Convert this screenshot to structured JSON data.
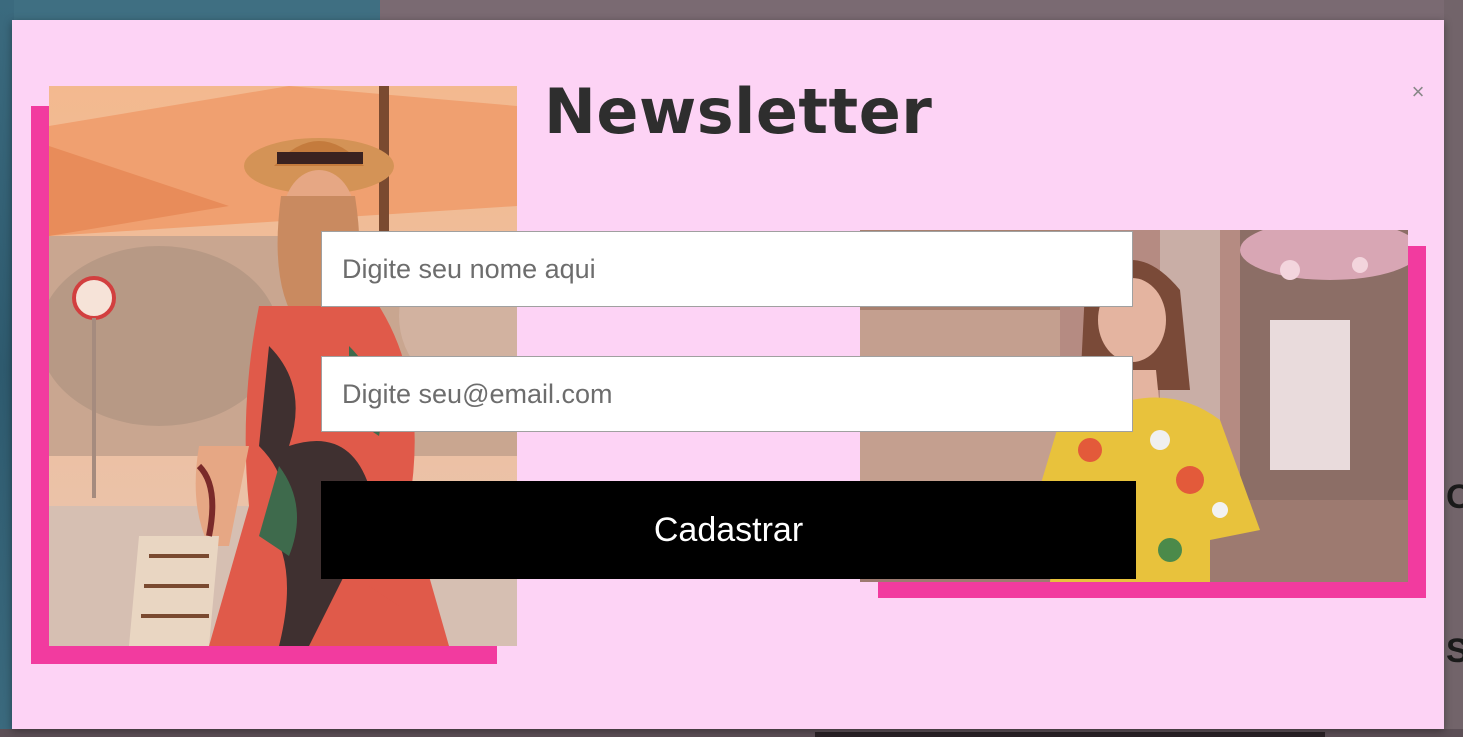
{
  "modal": {
    "title": "Newsletter",
    "close_symbol": "×",
    "name_placeholder": "Digite seu nome aqui",
    "email_placeholder": "Digite seu@email.com",
    "submit_label": "Cadastrar"
  },
  "colors": {
    "modal_background": "#fdd3f5",
    "accent_frame": "#f23b9f",
    "button_background": "#000000",
    "title_text": "#2e2e2e"
  },
  "icons": {
    "close": "close-icon"
  }
}
